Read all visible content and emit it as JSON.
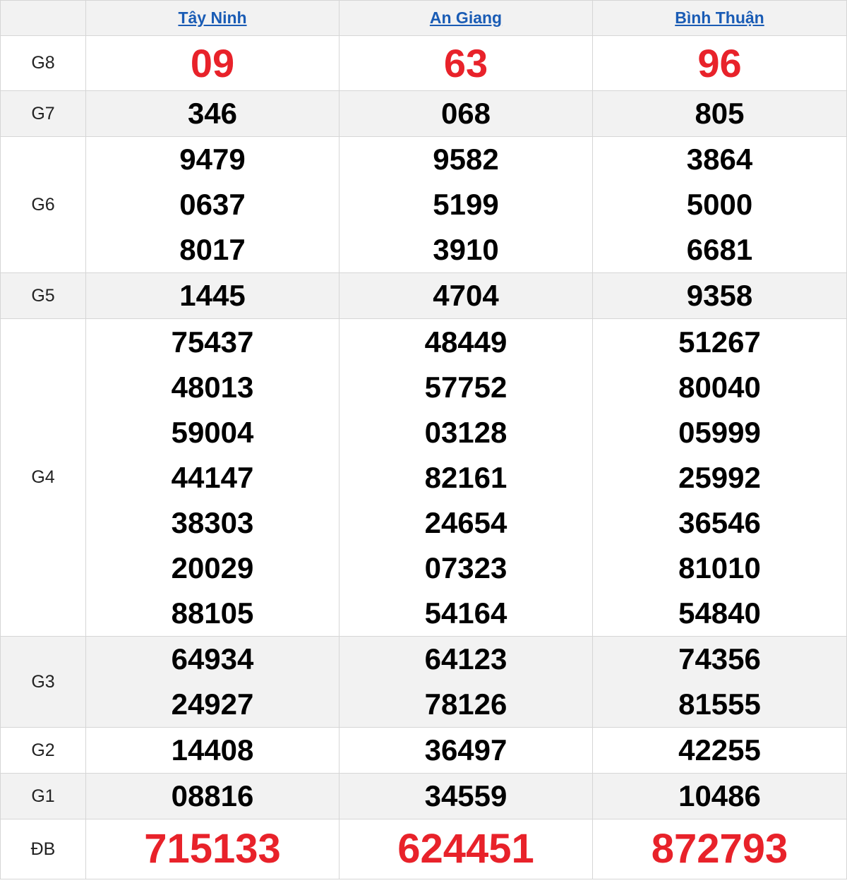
{
  "provinces": [
    "Tây Ninh",
    "An Giang",
    "Bình Thuận"
  ],
  "prizes": [
    {
      "label": "G8",
      "values": [
        [
          "09"
        ],
        [
          "63"
        ],
        [
          "96"
        ]
      ]
    },
    {
      "label": "G7",
      "values": [
        [
          "346"
        ],
        [
          "068"
        ],
        [
          "805"
        ]
      ]
    },
    {
      "label": "G6",
      "values": [
        [
          "9479",
          "0637",
          "8017"
        ],
        [
          "9582",
          "5199",
          "3910"
        ],
        [
          "3864",
          "5000",
          "6681"
        ]
      ]
    },
    {
      "label": "G5",
      "values": [
        [
          "1445"
        ],
        [
          "4704"
        ],
        [
          "9358"
        ]
      ]
    },
    {
      "label": "G4",
      "values": [
        [
          "75437",
          "48013",
          "59004",
          "44147",
          "38303",
          "20029",
          "88105"
        ],
        [
          "48449",
          "57752",
          "03128",
          "82161",
          "24654",
          "07323",
          "54164"
        ],
        [
          "51267",
          "80040",
          "05999",
          "25992",
          "36546",
          "81010",
          "54840"
        ]
      ]
    },
    {
      "label": "G3",
      "values": [
        [
          "64934",
          "24927"
        ],
        [
          "64123",
          "78126"
        ],
        [
          "74356",
          "81555"
        ]
      ]
    },
    {
      "label": "G2",
      "values": [
        [
          "14408"
        ],
        [
          "36497"
        ],
        [
          "42255"
        ]
      ]
    },
    {
      "label": "G1",
      "values": [
        [
          "08816"
        ],
        [
          "34559"
        ],
        [
          "10486"
        ]
      ]
    },
    {
      "label": "ĐB",
      "values": [
        [
          "715133"
        ],
        [
          "624451"
        ],
        [
          "872793"
        ]
      ]
    }
  ],
  "colors": {
    "link": "#1a5cb5",
    "highlight": "#e8222a",
    "alt_row": "#f2f2f2",
    "border": "#d6d6d6"
  }
}
